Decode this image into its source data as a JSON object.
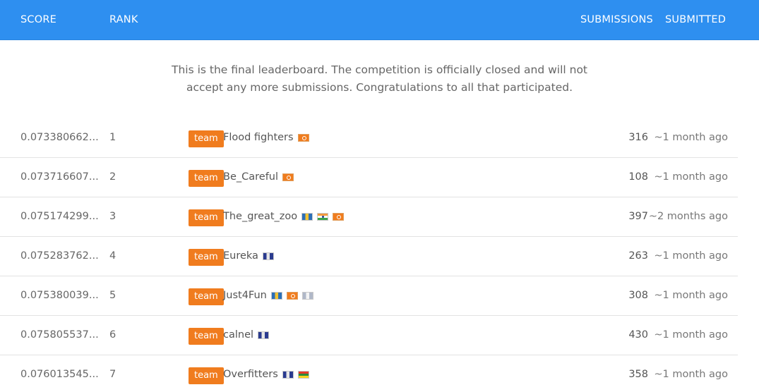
{
  "header": {
    "score": "SCORE",
    "rank": "RANK",
    "submissions": "SUBMISSIONS",
    "submitted": "SUBMITTED",
    "color": "#2e8ff0"
  },
  "notice": {
    "line1": "This is the final leaderboard. The competition is officially closed and will not",
    "line2": "accept any more submissions. Congratulations to all that participated."
  },
  "badge_color": "#f07c1e",
  "rows": [
    {
      "score": "0.073380662...",
      "rank": "1",
      "badge": "team",
      "name": "Flood fighters",
      "flags": [
        "orange"
      ],
      "submissions": "316",
      "submitted": "~1 month ago"
    },
    {
      "score": "0.073716607...",
      "rank": "2",
      "badge": "team",
      "name": "Be_Careful",
      "flags": [
        "orange"
      ],
      "submissions": "108",
      "submitted": "~1 month ago"
    },
    {
      "score": "0.075174299...",
      "rank": "3",
      "badge": "team",
      "name": "The_great_zoo",
      "flags": [
        "flagtri",
        "india",
        "orange"
      ],
      "submissions": "397",
      "submitted": "~2 months ago"
    },
    {
      "score": "0.075283762...",
      "rank": "4",
      "badge": "team",
      "name": "Eureka",
      "flags": [
        "blue"
      ],
      "submissions": "263",
      "submitted": "~1 month ago"
    },
    {
      "score": "0.075380039...",
      "rank": "5",
      "badge": "team",
      "name": "Just4Fun",
      "flags": [
        "flagtri",
        "orange",
        "gray"
      ],
      "submissions": "308",
      "submitted": "~1 month ago"
    },
    {
      "score": "0.075805537...",
      "rank": "6",
      "badge": "team",
      "name": "calnel",
      "flags": [
        "blue"
      ],
      "submissions": "430",
      "submitted": "~1 month ago"
    },
    {
      "score": "0.076013545...",
      "rank": "7",
      "badge": "team",
      "name": "Overfitters",
      "flags": [
        "blue",
        "multi"
      ],
      "submissions": "358",
      "submitted": "~1 month ago"
    }
  ]
}
